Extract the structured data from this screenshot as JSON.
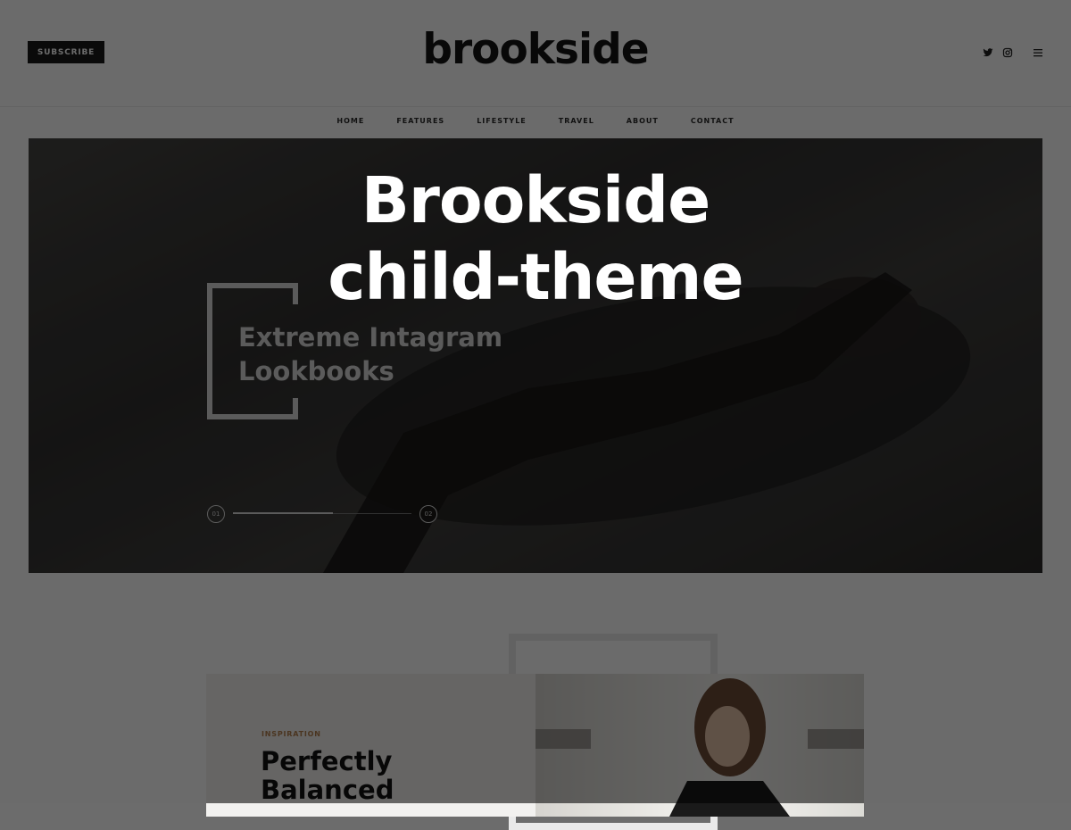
{
  "header": {
    "subscribe_label": "SUBSCRIBE",
    "logo": "brookside",
    "icons": [
      "twitter-icon",
      "instagram-icon",
      "menu-icon"
    ]
  },
  "nav": {
    "items": [
      "HOME",
      "FEATURES",
      "LIFESTYLE",
      "TRAVEL",
      "ABOUT",
      "CONTACT"
    ]
  },
  "hero": {
    "title": "Extreme Intagram Lookbooks",
    "slides": [
      "01",
      "02"
    ],
    "progress": 0.56
  },
  "post": {
    "category": "INSPIRATION",
    "title": "Perfectly Balanced"
  },
  "overlay": {
    "line1": "Brookside",
    "line2": "child-theme"
  }
}
